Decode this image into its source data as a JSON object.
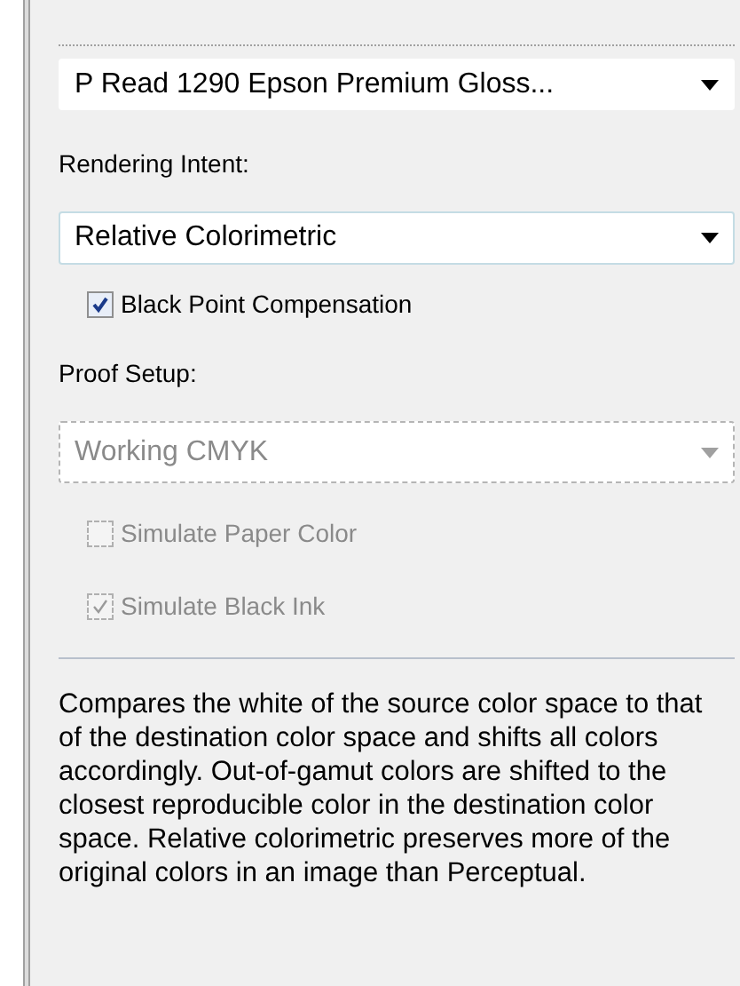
{
  "profile_dropdown": {
    "value": "P Read 1290 Epson Premium Gloss...",
    "disabled": false
  },
  "rendering_intent": {
    "label": "Rendering Intent:",
    "dropdown": {
      "value": "Relative Colorimetric",
      "disabled": false
    }
  },
  "black_point_compensation": {
    "label": "Black Point Compensation",
    "checked": true,
    "disabled": false
  },
  "proof_setup": {
    "label": "Proof Setup:",
    "dropdown": {
      "value": "Working CMYK",
      "disabled": true
    }
  },
  "proof_options": [
    {
      "label": "Simulate Paper Color",
      "checked": false,
      "disabled": true
    },
    {
      "label": "Simulate Black Ink",
      "checked": true,
      "disabled": true
    }
  ],
  "description": "Compares the white of the source color space to that of the destination color space and shifts all colors accordingly. Out-of-gamut colors are shifted to the closest reproducible color in the destination color space. Relative colorimetric preserves more of the original colors in an image than Perceptual."
}
